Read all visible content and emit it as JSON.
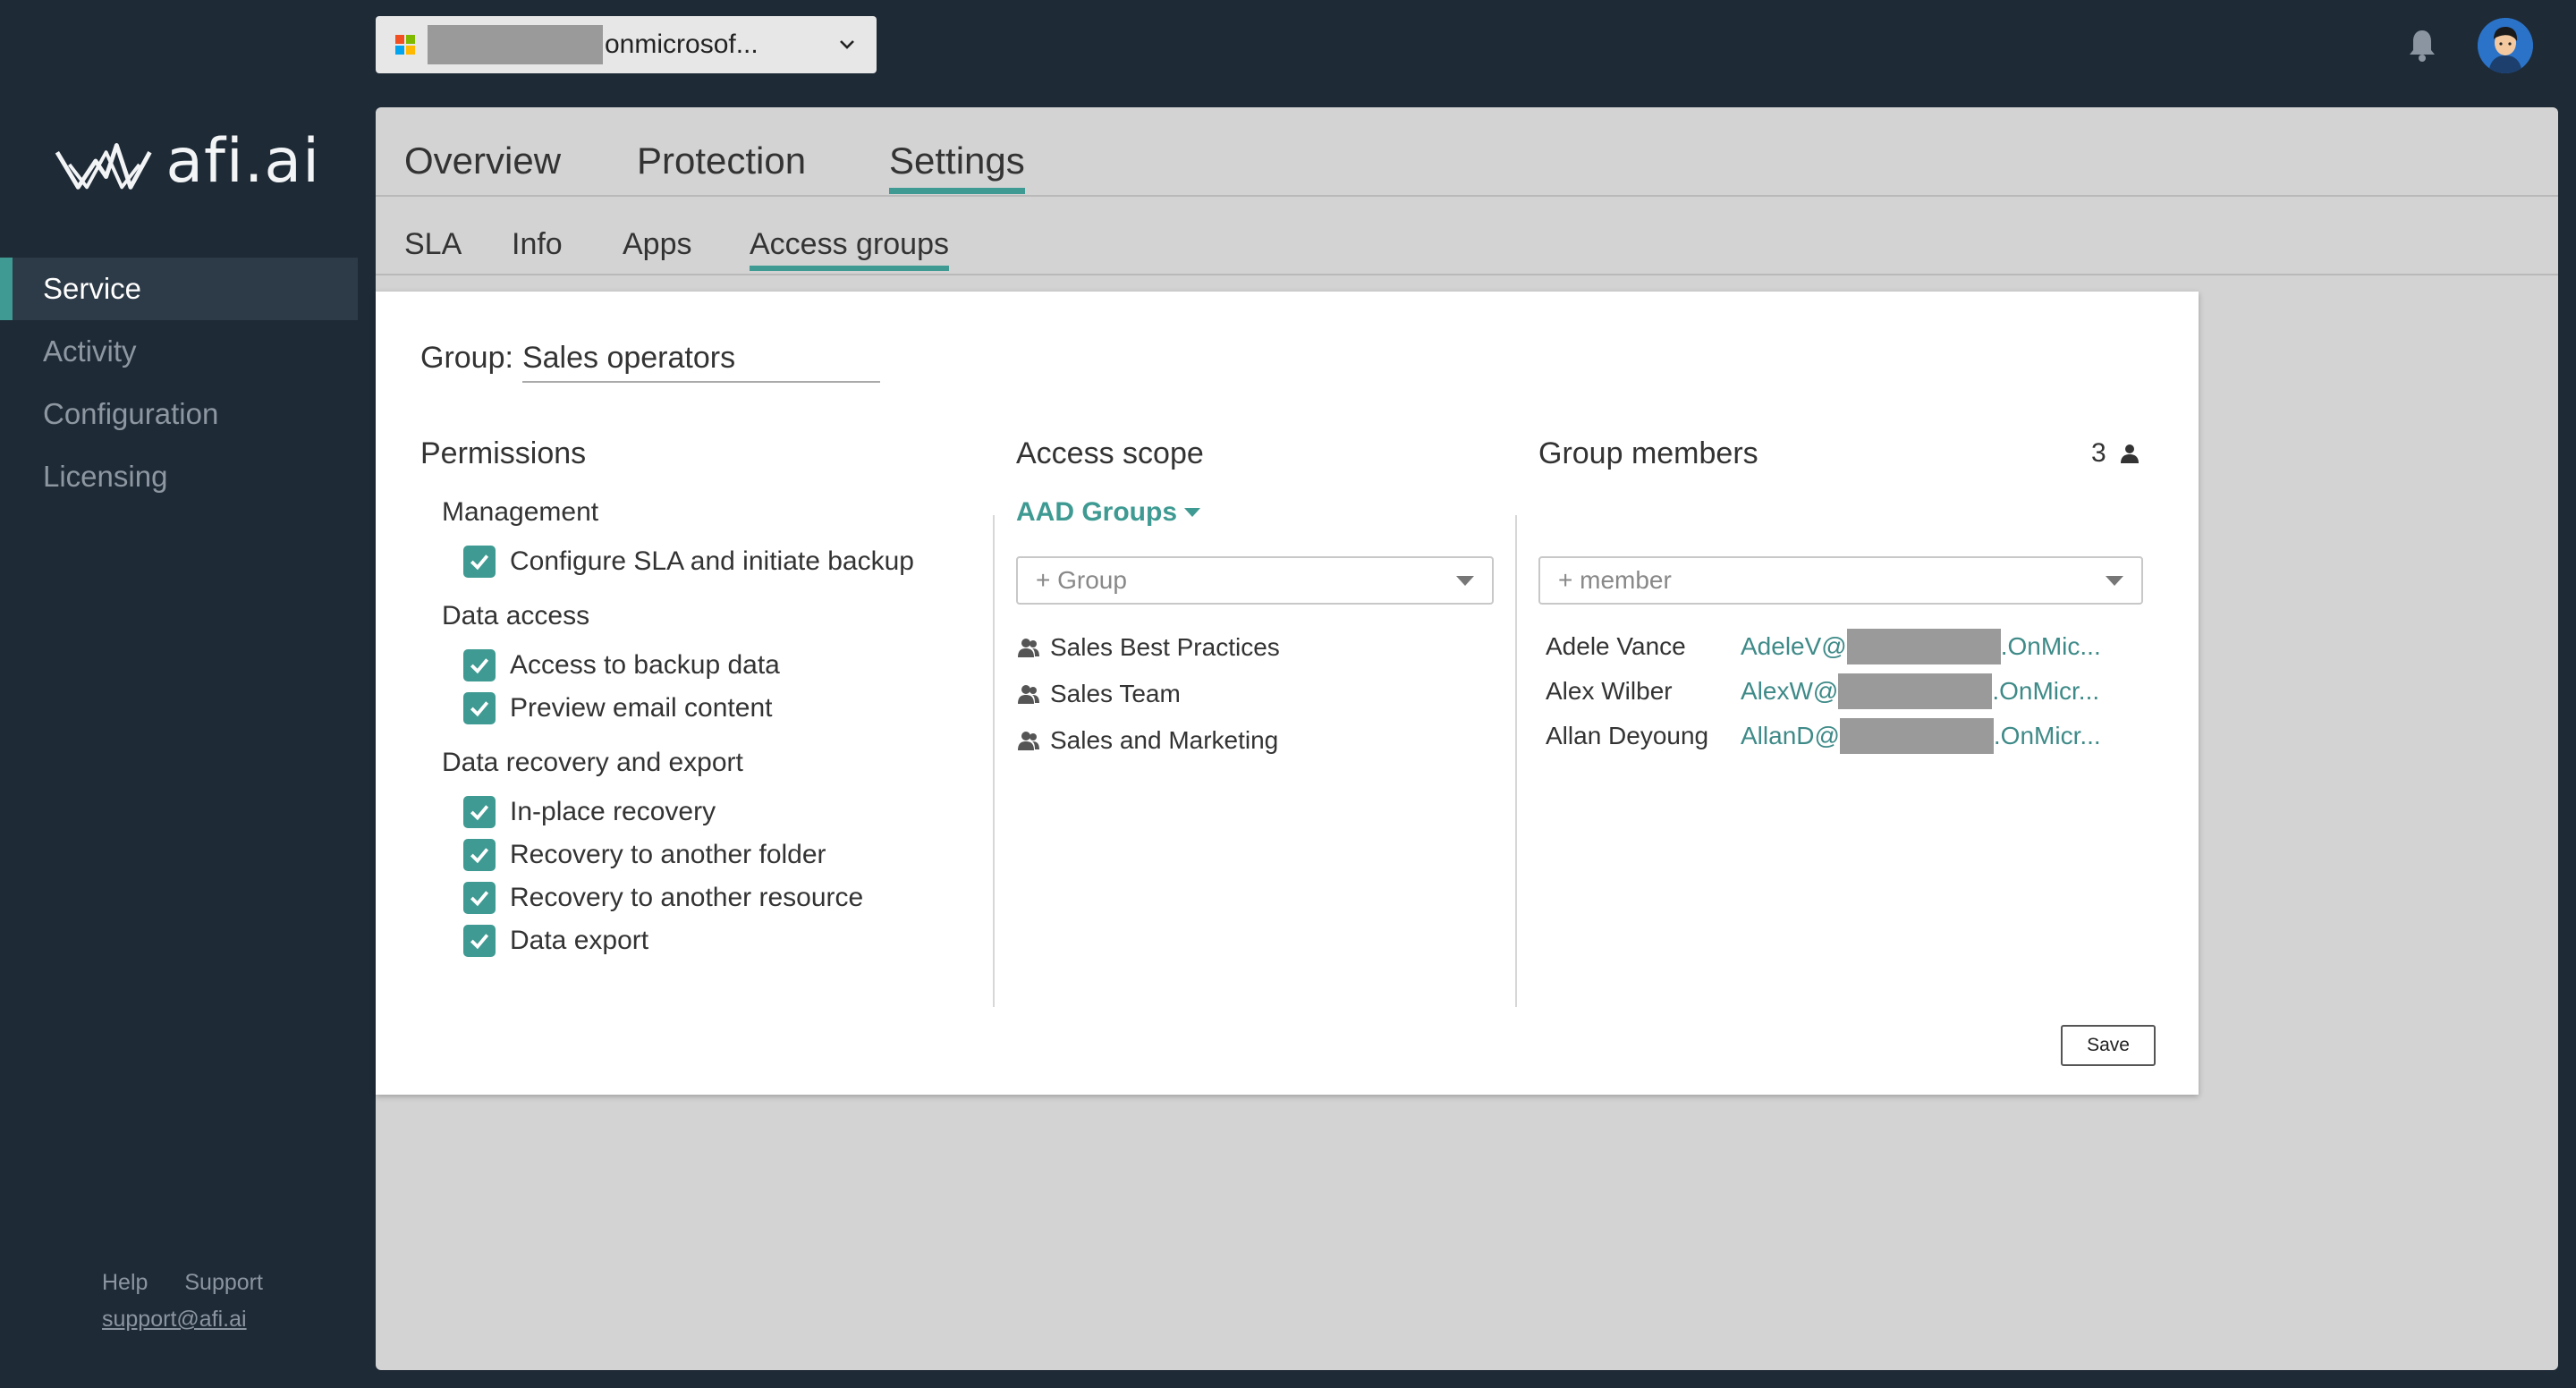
{
  "sidebar": {
    "logo_text": "afi.ai",
    "items": [
      {
        "label": "Service",
        "active": true
      },
      {
        "label": "Activity",
        "active": false
      },
      {
        "label": "Configuration",
        "active": false
      },
      {
        "label": "Licensing",
        "active": false
      }
    ],
    "help_label": "Help",
    "support_label": "Support",
    "support_email": "support@afi.ai"
  },
  "topbar": {
    "tenant_suffix": "onmicrosof..."
  },
  "tabs": [
    "Overview",
    "Protection",
    "Settings"
  ],
  "active_tab": "Settings",
  "subtabs": [
    "SLA",
    "Info",
    "Apps",
    "Access groups"
  ],
  "active_subtab": "Access groups",
  "group": {
    "label": "Group:",
    "name": "Sales operators"
  },
  "permissions": {
    "title": "Permissions",
    "sections": [
      {
        "title": "Management",
        "items": [
          {
            "label": "Configure SLA and initiate backup",
            "checked": true
          }
        ]
      },
      {
        "title": "Data access",
        "items": [
          {
            "label": "Access to backup data",
            "checked": true
          },
          {
            "label": "Preview email content",
            "checked": true
          }
        ]
      },
      {
        "title": "Data recovery and export",
        "items": [
          {
            "label": "In-place recovery",
            "checked": true
          },
          {
            "label": "Recovery to another folder",
            "checked": true
          },
          {
            "label": "Recovery to another resource",
            "checked": true
          },
          {
            "label": "Data export",
            "checked": true
          }
        ]
      }
    ]
  },
  "access_scope": {
    "title": "Access scope",
    "filter_label": "AAD Groups",
    "add_placeholder": "+ Group",
    "groups": [
      "Sales Best Practices",
      "Sales Team",
      "Sales and Marketing"
    ]
  },
  "members": {
    "title": "Group members",
    "count": "3",
    "add_placeholder": "+ member",
    "list": [
      {
        "name": "Adele Vance",
        "email_prefix": "AdeleV@",
        "email_suffix": ".OnMic..."
      },
      {
        "name": "Alex Wilber",
        "email_prefix": "AlexW@",
        "email_suffix": ".OnMicr..."
      },
      {
        "name": "Allan Deyoung",
        "email_prefix": "AllanD@",
        "email_suffix": ".OnMicr..."
      }
    ]
  },
  "save_label": "Save",
  "colors": {
    "accent": "#3e9a92",
    "sidebar_bg": "#1e2a36",
    "content_bg": "#d3d3d3"
  }
}
